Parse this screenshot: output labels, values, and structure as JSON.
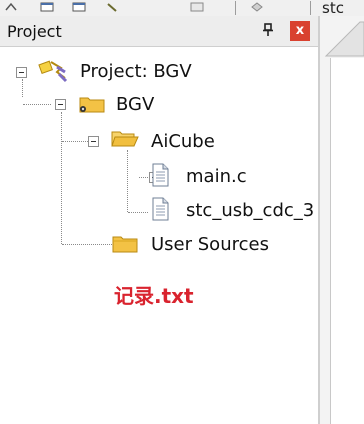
{
  "toolbar": {
    "partial_text": "stc"
  },
  "panel": {
    "title": "Project",
    "pin_icon": "pin-icon",
    "close_label": "x"
  },
  "tree": {
    "root": "Project: BGV",
    "target": "BGV",
    "groups": [
      {
        "label": "AiCube",
        "files": [
          "main.c",
          "stc_usb_cdc_3"
        ]
      },
      {
        "label": "User Sources"
      }
    ]
  },
  "annotation": "记录.txt",
  "colors": {
    "close": "#d9412f",
    "annotation": "#d9232e"
  }
}
